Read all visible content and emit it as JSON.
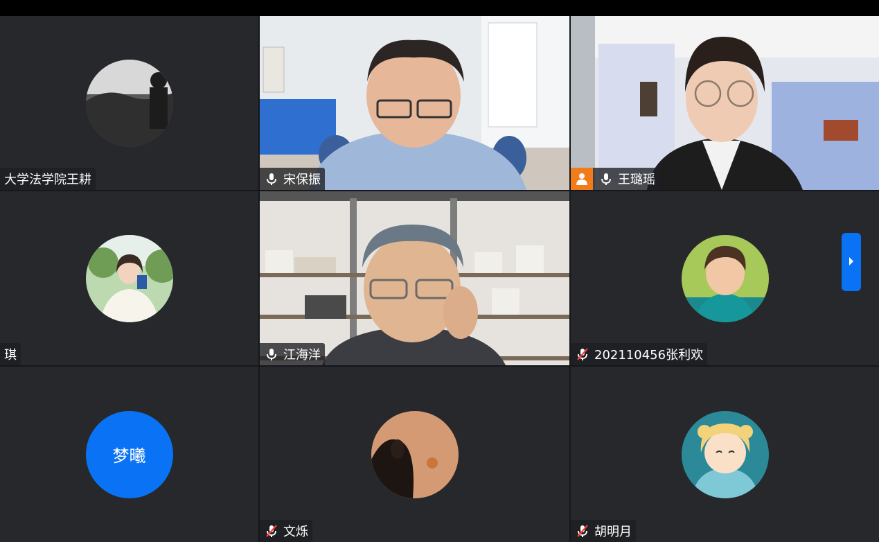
{
  "participants": [
    {
      "name": "大学法学院王耕",
      "mic": "none",
      "type": "avatar"
    },
    {
      "name": "宋保振",
      "mic": "on",
      "type": "video"
    },
    {
      "name": "王璐瑶",
      "mic": "on",
      "type": "video",
      "host": true
    },
    {
      "name": "琪",
      "mic": "none",
      "type": "avatar"
    },
    {
      "name": "江海洋",
      "mic": "on",
      "type": "video"
    },
    {
      "name": "202110456张利欢",
      "mic": "muted",
      "type": "avatar"
    },
    {
      "name": "梦曦",
      "mic": "none",
      "type": "initials",
      "initials": "梦曦"
    },
    {
      "name": "文烁",
      "mic": "muted",
      "type": "avatar"
    },
    {
      "name": "胡明月",
      "mic": "muted",
      "type": "avatar"
    }
  ],
  "colors": {
    "accent": "#0a73f5",
    "host_badge": "#f27c1b",
    "tile_bg": "#26282c"
  },
  "icons": {
    "mic_on": "microphone-icon",
    "mic_muted": "microphone-muted-icon",
    "host": "host-person-icon",
    "next": "chevron-right-icon"
  }
}
